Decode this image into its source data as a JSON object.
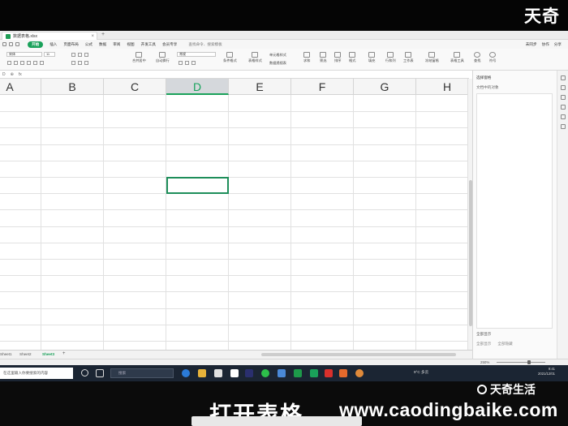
{
  "watermark": {
    "brand": "天奇",
    "brand_bottom": "天奇生活",
    "caption": "打开表格",
    "url": "www.caodingbaike.com"
  },
  "titlebar": {
    "doc_name": "数据表格.xlsx",
    "close": "×",
    "add": "+"
  },
  "menu": {
    "start": "开始",
    "items": [
      "插入",
      "页面布局",
      "公式",
      "数据",
      "审阅",
      "视图",
      "开发工具",
      "会员专享"
    ],
    "search": "查找命令、搜索模板",
    "right": [
      "未同步",
      "协作",
      "分享"
    ]
  },
  "ribbon": {
    "font_name": "宋体",
    "font_size": "11",
    "number_format": "常规",
    "buttons": [
      "合并居中",
      "自动换行",
      "条件格式",
      "表格样式",
      "求和",
      "筛选",
      "排序",
      "格式",
      "填充",
      "行和列",
      "工作表",
      "冻结窗格",
      "表格工具",
      "查找",
      "符号"
    ],
    "small": [
      "表格样式",
      "单元格样式",
      "数据透视表"
    ]
  },
  "formula_bar": {
    "cell_ref": "D",
    "fx": "fx"
  },
  "columns": [
    {
      "label": "A",
      "selected": false
    },
    {
      "label": "B",
      "selected": false
    },
    {
      "label": "C",
      "selected": false
    },
    {
      "label": "D",
      "selected": true
    },
    {
      "label": "E",
      "selected": false
    },
    {
      "label": "F",
      "selected": false
    },
    {
      "label": "G",
      "selected": false
    },
    {
      "label": "H",
      "selected": false
    }
  ],
  "sheets": [
    {
      "label": "Sheet1",
      "active": false
    },
    {
      "label": "Sheet2",
      "active": false
    },
    {
      "label": "Sheet3",
      "active": true
    }
  ],
  "sheet_add": "+",
  "pane": {
    "title": "选择窗格",
    "subtitle": "文档中的对象",
    "footer": "全部显示",
    "btn1": "全部显示",
    "btn2": "全部隐藏"
  },
  "status": {
    "zoom": "250%"
  },
  "taskbar": {
    "left_search": "在这里输入你要搜索的内容",
    "search": "搜索",
    "weather": "9°C 多云",
    "time": "9:41",
    "date": "2021/12/01"
  },
  "colors": {
    "accent": "#1aa15a",
    "active_cell": "#1e8e5a",
    "taskbar": "#1b2533"
  }
}
